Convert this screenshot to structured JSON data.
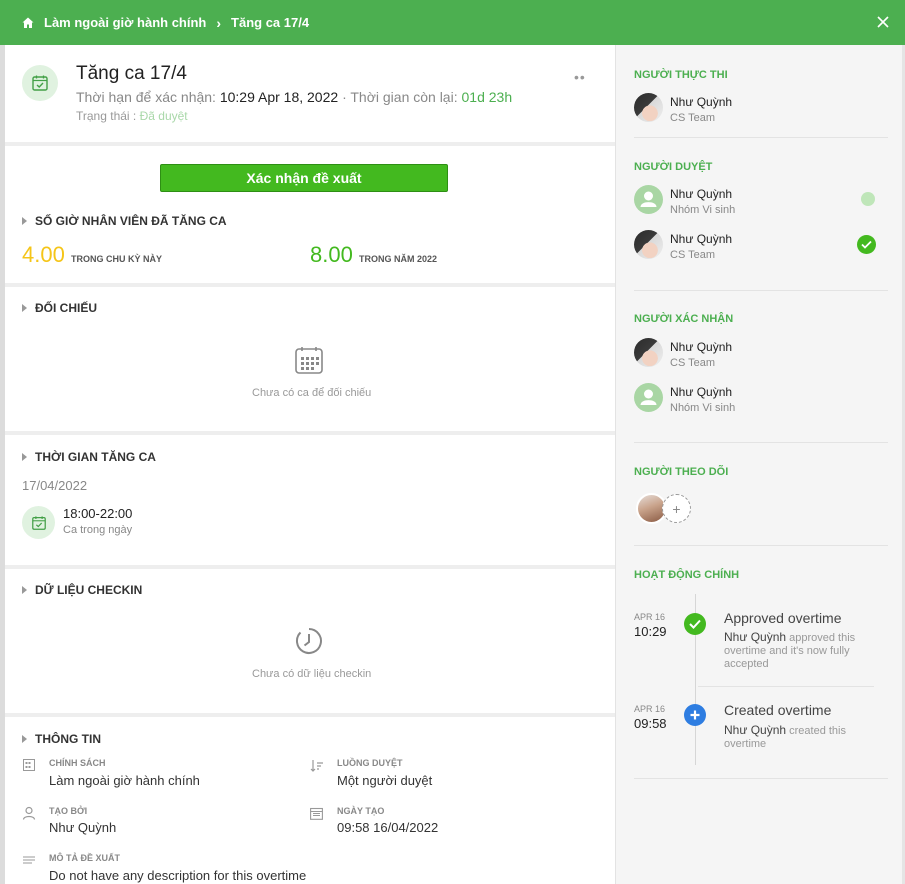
{
  "breadcrumb": {
    "parent": "Làm ngoài giờ hành chính",
    "separator": "›",
    "current": "Tăng ca 17/4"
  },
  "header": {
    "title": "Tăng ca 17/4",
    "deadline_label": "Thời hạn để xác nhận:",
    "deadline_value": "10:29 Apr 18, 2022",
    "remaining_label": "· Thời gian còn lại:",
    "remaining_value": "01d 23h",
    "status_label": "Trạng thái :",
    "status_value": "Đã duyệt",
    "more": "••"
  },
  "actions": {
    "confirm_label": "Xác nhận đề xuất"
  },
  "overtime_hours": {
    "section_title": "SỐ GIỜ NHÂN VIÊN ĐÃ TĂNG CA",
    "cycle_value": "4.00",
    "cycle_label": "TRONG CHU KỲ NÀY",
    "year_value": "8.00",
    "year_label": "TRONG NĂM 2022"
  },
  "compare": {
    "section_title": "ĐỐI CHIẾU",
    "empty_text": "Chưa có ca để đối chiếu"
  },
  "overtime_time": {
    "section_title": "THỜI GIAN TĂNG CA",
    "date": "17/04/2022",
    "shift_time": "18:00-22:00",
    "shift_name": "Ca trong ngày"
  },
  "checkin": {
    "section_title": "DỮ LIỆU CHECKIN",
    "empty_text": "Chưa có dữ liệu checkin"
  },
  "info": {
    "section_title": "THÔNG TIN",
    "policy_label": "CHÍNH SÁCH",
    "policy_value": "Làm ngoài giờ hành chính",
    "flow_label": "LUỒNG DUYỆT",
    "flow_value": "Một người duyệt",
    "creator_label": "TẠO BỞI",
    "creator_value": "Như Quỳnh",
    "created_label": "NGÀY TẠO",
    "created_value": "09:58 16/04/2022",
    "desc_label": "MÔ TẢ ĐỀ XUẤT",
    "desc_value": "Do not have any description for this overtime"
  },
  "sidebar": {
    "executor_title": "NGƯỜI THỰC THI",
    "executor": {
      "name": "Như Quỳnh",
      "team": "CS Team"
    },
    "approver_title": "NGƯỜI DUYỆT",
    "approvers": [
      {
        "name": "Như Quỳnh",
        "team": "Nhóm Vi sinh"
      },
      {
        "name": "Như Quỳnh",
        "team": "CS Team"
      }
    ],
    "confirmer_title": "NGƯỜI XÁC NHẬN",
    "confirmers": [
      {
        "name": "Như Quỳnh",
        "team": "CS Team"
      },
      {
        "name": "Như Quỳnh",
        "team": "Nhóm Vi sinh"
      }
    ],
    "follower_title": "NGƯỜI THEO DÕI",
    "add_symbol": "+",
    "activity_title": "HOẠT ĐỘNG CHÍNH",
    "activities": [
      {
        "month": "APR 16",
        "time": "10:29",
        "title": "Approved overtime",
        "actor": "Như Quỳnh",
        "desc": "approved this overtime and it's now fully accepted"
      },
      {
        "month": "APR 16",
        "time": "09:58",
        "title": "Created overtime",
        "actor": "Như Quỳnh",
        "desc": "created this overtime"
      }
    ]
  },
  "colors": {
    "brand": "#4caf50",
    "button": "#43b91f",
    "yellow": "#f5c518",
    "blue": "#2e7de1"
  }
}
